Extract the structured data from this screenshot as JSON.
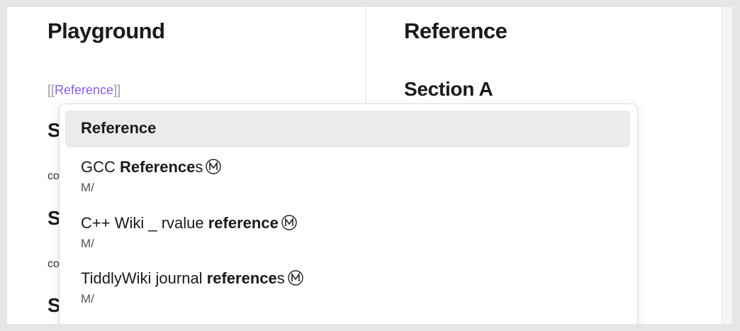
{
  "left_pane": {
    "title": "Playground",
    "wikilink_open": "[[",
    "wikilink_text": "Reference",
    "wikilink_close": "]]",
    "partial_heading_1": "S",
    "partial_text_1": "co",
    "partial_heading_2": "S",
    "partial_text_2": "co",
    "partial_heading_3": "S"
  },
  "right_pane": {
    "title": "Reference",
    "section_heading": "Section A"
  },
  "suggestions": {
    "selected": {
      "title": "Reference"
    },
    "items": [
      {
        "prefix": "GCC ",
        "match": "Reference",
        "suffix": "s",
        "icon": "circled-m-icon",
        "path": "M/"
      },
      {
        "prefix": "C++ Wiki _ rvalue ",
        "match": "reference",
        "suffix": "",
        "icon": "circled-m-icon",
        "path": "M/"
      },
      {
        "prefix": "TiddlyWiki journal ",
        "match": "reference",
        "suffix": "s",
        "icon": "circled-m-icon",
        "path": "M/"
      }
    ]
  },
  "colors": {
    "link_accent": "#8a5cf5",
    "selected_bg": "#ebebed"
  }
}
